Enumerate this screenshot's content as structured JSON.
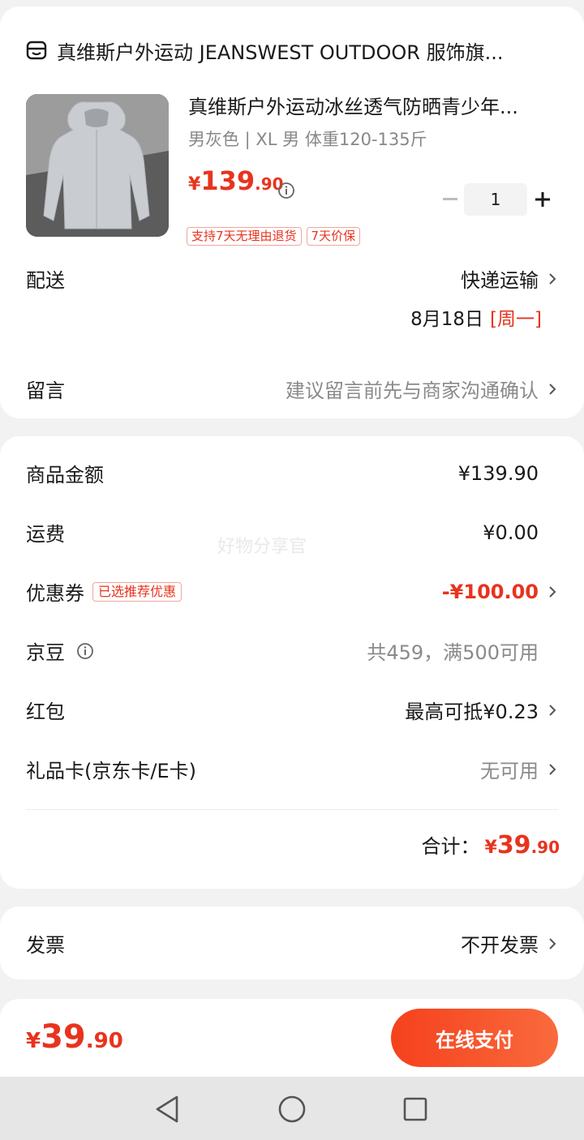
{
  "colors": {
    "accent": "#e8331e",
    "pay_button_start": "#f5411d",
    "pay_button_end": "#f96a3c",
    "page_bg": "#f2f2f2"
  },
  "store": {
    "icon": "store-icon",
    "name": "真维斯户外运动 JEANSWEST OUTDOOR 服饰旗..."
  },
  "product": {
    "title": "真维斯户外运动冰丝透气防晒青少年...",
    "spec": "男灰色 | XL 男 体重120-135斤",
    "price": {
      "currency": "¥",
      "integer": "139",
      "decimal": ".90"
    },
    "price_info_icon": "info-icon",
    "quantity": "1",
    "minus_label": "−",
    "plus_label": "+",
    "tags": [
      "支持7天无理由退货",
      "7天价保"
    ]
  },
  "delivery": {
    "label": "配送",
    "method": "快递运输",
    "date": "8月18日",
    "weekday": "[周一]"
  },
  "message": {
    "label": "留言",
    "placeholder": "建议留言前先与商家沟通确认"
  },
  "summary": {
    "goods_amount": {
      "label": "商品金额",
      "value": "¥139.90"
    },
    "shipping": {
      "label": "运费",
      "value": "¥0.00"
    },
    "watermark": "好物分享官",
    "coupon": {
      "label": "优惠券",
      "badge": "已选推荐优惠",
      "value": "-¥100.00"
    },
    "jd_beans": {
      "label": "京豆",
      "value": "共459，满500可用"
    },
    "red_packet": {
      "label": "红包",
      "value": "最高可抵¥0.23"
    },
    "gift_card": {
      "label": "礼品卡(京东卡/E卡)",
      "value": "无可用"
    },
    "total": {
      "label": "合计：",
      "currency": "¥",
      "integer": "39",
      "decimal": ".90"
    }
  },
  "invoice": {
    "label": "发票",
    "value": "不开发票"
  },
  "checkout": {
    "currency": "¥",
    "integer": "39",
    "decimal": ".90",
    "pay_label": "在线支付"
  },
  "nav": {
    "back_icon": "back-triangle-icon",
    "home_icon": "home-circle-icon",
    "recents_icon": "recents-square-icon"
  }
}
